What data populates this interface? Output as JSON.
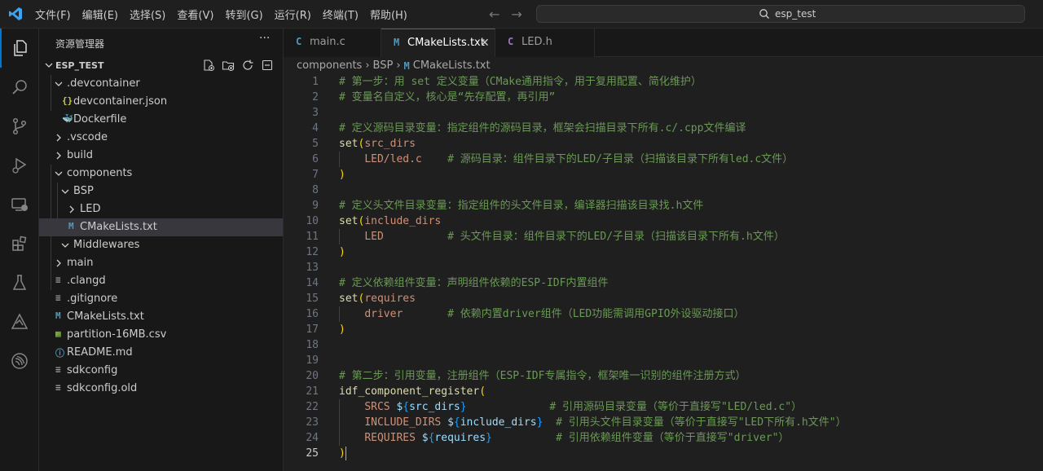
{
  "window": {
    "search_text": "esp_test"
  },
  "menu": [
    "文件(F)",
    "编辑(E)",
    "选择(S)",
    "查看(V)",
    "转到(G)",
    "运行(R)",
    "终端(T)",
    "帮助(H)"
  ],
  "sidebar": {
    "title": "资源管理器",
    "more": "···",
    "root": "ESP_TEST",
    "tree": [
      {
        "label": ".devcontainer",
        "type": "folder",
        "open": true
      },
      {
        "label": "devcontainer.json",
        "type": "json"
      },
      {
        "label": "Dockerfile",
        "type": "docker"
      },
      {
        "label": ".vscode",
        "type": "folder",
        "open": false
      },
      {
        "label": "build",
        "type": "folder",
        "open": false
      },
      {
        "label": "components",
        "type": "folder",
        "open": true
      },
      {
        "label": "BSP",
        "type": "folder",
        "open": true
      },
      {
        "label": "LED",
        "type": "folder",
        "open": false
      },
      {
        "label": "CMakeLists.txt",
        "type": "cmake",
        "selected": true
      },
      {
        "label": "Middlewares",
        "type": "folder",
        "open": true
      },
      {
        "label": "main",
        "type": "folder",
        "open": false
      },
      {
        "label": ".clangd",
        "type": "text"
      },
      {
        "label": ".gitignore",
        "type": "text"
      },
      {
        "label": "CMakeLists.txt",
        "type": "cmake"
      },
      {
        "label": "partition-16MB.csv",
        "type": "csv"
      },
      {
        "label": "README.md",
        "type": "info"
      },
      {
        "label": "sdkconfig",
        "type": "text"
      },
      {
        "label": "sdkconfig.old",
        "type": "text"
      }
    ]
  },
  "tabs": [
    {
      "icon": "C",
      "label": "main.c",
      "active": false
    },
    {
      "icon": "M",
      "label": "CMakeLists.txt",
      "active": true,
      "close": "✕"
    },
    {
      "icon": "C",
      "label": "LED.h",
      "active": false
    }
  ],
  "breadcrumb": [
    "components",
    "BSP",
    "CMakeLists.txt"
  ],
  "editor": {
    "current_line": 25,
    "lines": [
      "# 第一步：用 set 定义变量（CMake通用指令，用于复用配置、简化维护）",
      "# 变量名自定义，核心是“先存配置，再引用”",
      "",
      "# 定义源码目录变量：指定组件的源码目录，框架会扫描目录下所有.c/.cpp文件编译",
      "set(src_dirs",
      "    LED/led.c    # 源码目录：组件目录下的LED/子目录（扫描该目录下所有led.c文件）",
      ")",
      "",
      "# 定义头文件目录变量：指定组件的头文件目录，编译器扫描该目录找.h文件",
      "set(include_dirs",
      "    LED          # 头文件目录：组件目录下的LED/子目录（扫描该目录下所有.h文件）",
      ")",
      "",
      "# 定义依赖组件变量：声明组件依赖的ESP-IDF内置组件",
      "set(requires",
      "    driver       # 依赖内置driver组件（LED功能需调用GPIO外设驱动接口）",
      ")",
      "",
      "",
      "# 第二步：引用变量，注册组件（ESP-IDF专属指令，框架唯一识别的组件注册方式）",
      "idf_component_register(",
      "    SRCS ${src_dirs}             # 引用源码目录变量（等价于直接写\"LED/led.c\"）",
      "    INCLUDE_DIRS ${include_dirs}  # 引用头文件目录变量（等价于直接写\"LED下所有.h文件\"）",
      "    REQUIRES ${requires}          # 引用依赖组件变量（等价于直接写\"driver\"）",
      ")"
    ]
  }
}
